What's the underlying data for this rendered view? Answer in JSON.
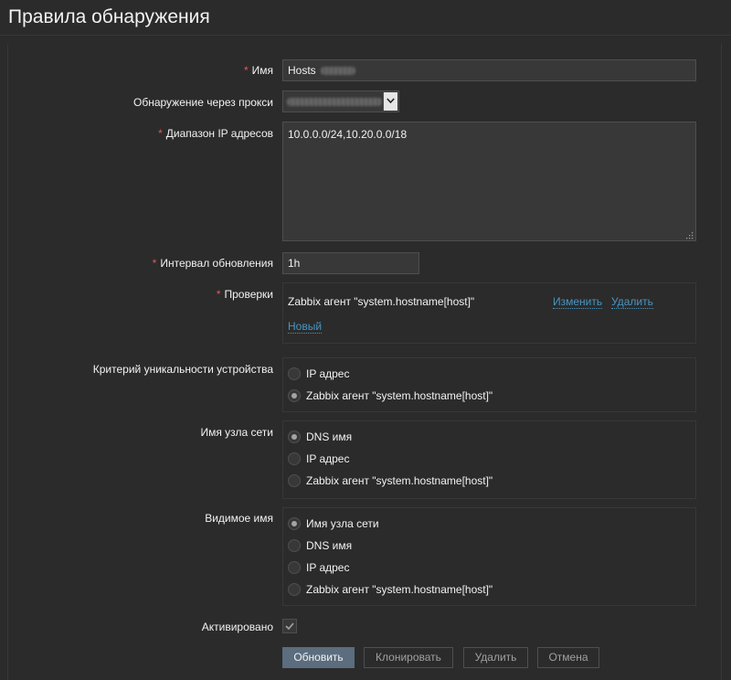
{
  "page": {
    "title": "Правила обнаружения"
  },
  "form": {
    "name": {
      "label": "Имя",
      "value": "Hosts"
    },
    "proxy": {
      "label": "Обнаружение через прокси"
    },
    "ip_range": {
      "label": "Диапазон IP адресов",
      "value": "10.0.0.0/24,10.20.0.0/18"
    },
    "interval": {
      "label": "Интервал обновления",
      "value": "1h"
    },
    "checks": {
      "label": "Проверки",
      "items": [
        {
          "text": "Zabbix агент \"system.hostname[host]\"",
          "edit": "Изменить",
          "remove": "Удалить"
        }
      ],
      "new_link": "Новый"
    },
    "uniqueness": {
      "label": "Критерий уникальности устройства",
      "options": [
        "IP адрес",
        "Zabbix агент \"system.hostname[host]\""
      ],
      "selected": 1
    },
    "host_name": {
      "label": "Имя узла сети",
      "options": [
        "DNS имя",
        "IP адрес",
        "Zabbix агент \"system.hostname[host]\""
      ],
      "selected": 0
    },
    "visible_name": {
      "label": "Видимое имя",
      "options": [
        "Имя узла сети",
        "DNS имя",
        "IP адрес",
        "Zabbix агент \"system.hostname[host]\""
      ],
      "selected": 0
    },
    "enabled": {
      "label": "Активировано",
      "checked": true
    }
  },
  "buttons": {
    "update": "Обновить",
    "clone": "Клонировать",
    "delete": "Удалить",
    "cancel": "Отмена"
  },
  "colors": {
    "background": "#2b2b2b",
    "field": "#383838",
    "border": "#4f4f4f",
    "link": "#4796c4",
    "required": "#e45959",
    "primary_button": "#5b6d7e"
  },
  "icons": {
    "select_arrow": "chevron-down-icon",
    "checkbox_mark": "checkmark-icon",
    "resize": "resize-grip-icon"
  }
}
